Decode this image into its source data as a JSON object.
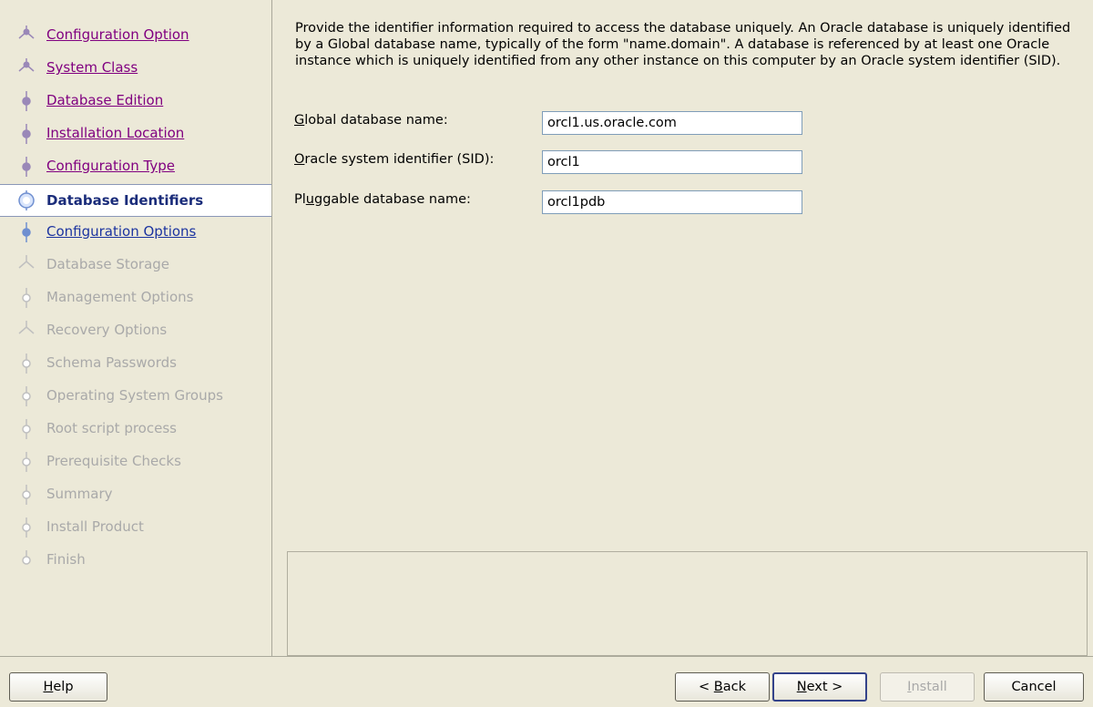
{
  "steps": [
    {
      "label": "Configuration Option",
      "state": "done",
      "icon": "fork-icon"
    },
    {
      "label": "System Class",
      "state": "done",
      "icon": "fork-icon"
    },
    {
      "label": "Database Edition",
      "state": "done",
      "icon": "dot-icon"
    },
    {
      "label": "Installation Location",
      "state": "done",
      "icon": "dot-icon"
    },
    {
      "label": "Configuration Type",
      "state": "done",
      "icon": "dot-icon"
    },
    {
      "label": "Database Identifiers",
      "state": "current",
      "icon": "current-step-icon"
    },
    {
      "label": "Configuration Options",
      "state": "next",
      "icon": "dot-icon"
    },
    {
      "label": "Database Storage",
      "state": "pending",
      "icon": "fork-icon"
    },
    {
      "label": "Management Options",
      "state": "pending",
      "icon": "dot-icon"
    },
    {
      "label": "Recovery Options",
      "state": "pending",
      "icon": "fork-icon"
    },
    {
      "label": "Schema Passwords",
      "state": "pending",
      "icon": "dot-icon"
    },
    {
      "label": "Operating System Groups",
      "state": "pending",
      "icon": "dot-icon"
    },
    {
      "label": "Root script process",
      "state": "pending",
      "icon": "dot-icon"
    },
    {
      "label": "Prerequisite Checks",
      "state": "pending",
      "icon": "dot-icon"
    },
    {
      "label": "Summary",
      "state": "pending",
      "icon": "dot-icon"
    },
    {
      "label": "Install Product",
      "state": "pending",
      "icon": "dot-icon"
    },
    {
      "label": "Finish",
      "state": "pending",
      "icon": "end-icon"
    }
  ],
  "main": {
    "description": "Provide the identifier information required to access the database uniquely. An Oracle database is uniquely identified by a Global database name, typically of the form \"name.domain\". A database is referenced by at least one Oracle instance which is uniquely identified from any other instance on this computer by an Oracle system identifier (SID).",
    "global_db": {
      "mnemonic": "G",
      "label_rest": "lobal database name:",
      "value": "orcl1.us.oracle.com"
    },
    "sid": {
      "mnemonic": "O",
      "label_rest": "racle system identifier (SID):",
      "value": "orcl1"
    },
    "pdb": {
      "label_pre": "Pl",
      "mnemonic": "u",
      "label_rest": "ggable database name:",
      "value": "orcl1pdb"
    }
  },
  "buttons": {
    "help": {
      "mnemonic": "H",
      "rest": "elp"
    },
    "back": {
      "pre": "< ",
      "mnemonic": "B",
      "rest": "ack"
    },
    "next": {
      "mnemonic": "N",
      "rest": "ext >"
    },
    "install": {
      "mnemonic": "I",
      "rest": "nstall"
    },
    "cancel": "Cancel"
  },
  "colors": {
    "done_link": "#800080",
    "next_link": "#1c34a0",
    "pending": "#a9a9a9",
    "current_text": "#1a2c7a",
    "icon_done": "#9a88b8",
    "icon_pending": "#c0c0c0",
    "icon_active": "#6f8fd0"
  }
}
